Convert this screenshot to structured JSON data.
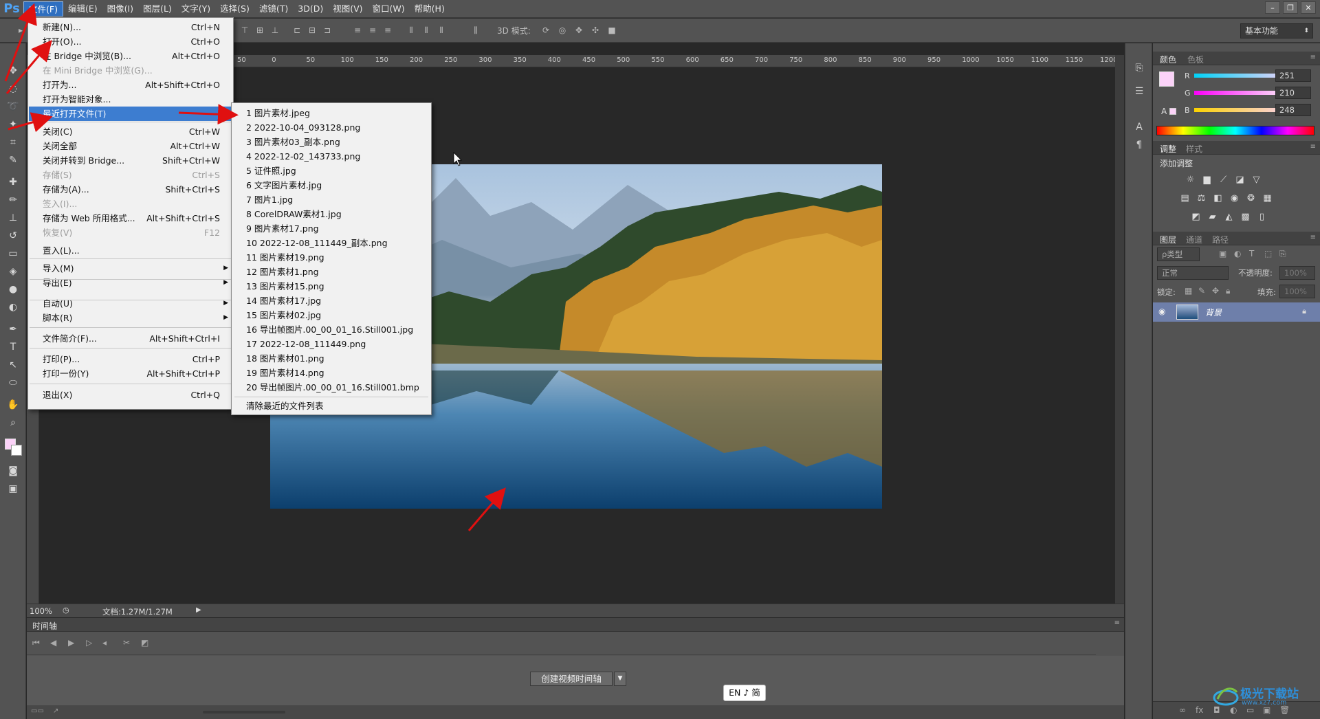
{
  "app": {
    "logo": "Ps"
  },
  "menubar": {
    "items": [
      "文件(F)",
      "编辑(E)",
      "图像(I)",
      "图层(L)",
      "文字(Y)",
      "选择(S)",
      "滤镜(T)",
      "3D(D)",
      "视图(V)",
      "窗口(W)",
      "帮助(H)"
    ],
    "active": "文件(F)",
    "window_controls": [
      "minimize",
      "restore",
      "close"
    ]
  },
  "options_bar": {
    "mode_label": "3D 模式:",
    "workspace": "基本功能"
  },
  "ruler": {
    "ticks": [
      "50",
      "0",
      "50",
      "100",
      "150",
      "200",
      "250",
      "300",
      "350",
      "400",
      "450",
      "500",
      "550",
      "600",
      "650",
      "700",
      "750",
      "800",
      "850",
      "900",
      "950",
      "1000",
      "1050",
      "1100",
      "1150",
      "1200"
    ]
  },
  "status": {
    "zoom": "100%",
    "doc_info": "文档:1.27M/1.27M"
  },
  "timeline": {
    "title": "时间轴",
    "create_button": "创建视频时间轴"
  },
  "ime": {
    "text": "EN ♪ 简"
  },
  "panels": {
    "color_tabs": [
      "颜色",
      "色板"
    ],
    "color": {
      "fg": "#fbd2f8",
      "r_label": "R",
      "g_label": "G",
      "b_label": "B",
      "r": "251",
      "g": "210",
      "b": "248"
    },
    "adj_tabs": [
      "调整",
      "样式"
    ],
    "adj_title": "添加调整",
    "layers_tabs": [
      "图层",
      "通道",
      "路径"
    ],
    "layer_filter": "ρ类型",
    "blend_mode": "正常",
    "opacity_label": "不透明度:",
    "opacity_value": "100%",
    "lock_label": "锁定:",
    "fill_label": "填充:",
    "fill_value": "100%",
    "layer_name": "背景"
  },
  "file_menu": {
    "items": [
      {
        "label": "新建(N)...",
        "shortcut": "Ctrl+N"
      },
      {
        "label": "打开(O)...",
        "shortcut": "Ctrl+O"
      },
      {
        "label": "在 Bridge 中浏览(B)...",
        "shortcut": "Alt+Ctrl+O"
      },
      {
        "label": "在 Mini Bridge 中浏览(G)...",
        "shortcut": "",
        "disabled": true
      },
      {
        "label": "打开为...",
        "shortcut": "Alt+Shift+Ctrl+O"
      },
      {
        "label": "打开为智能对象...",
        "shortcut": ""
      },
      {
        "label": "最近打开文件(T)",
        "shortcut": "",
        "submenu": true,
        "highlighted": true
      },
      {
        "label": "关闭(C)",
        "shortcut": "Ctrl+W"
      },
      {
        "label": "关闭全部",
        "shortcut": "Alt+Ctrl+W"
      },
      {
        "label": "关闭并转到 Bridge...",
        "shortcut": "Shift+Ctrl+W"
      },
      {
        "label": "存储(S)",
        "shortcut": "Ctrl+S",
        "disabled": true
      },
      {
        "label": "存储为(A)...",
        "shortcut": "Shift+Ctrl+S"
      },
      {
        "label": "签入(I)...",
        "shortcut": "",
        "disabled": true
      },
      {
        "label": "存储为 Web 所用格式...",
        "shortcut": "Alt+Shift+Ctrl+S"
      },
      {
        "label": "恢复(V)",
        "shortcut": "F12",
        "disabled": true
      },
      {
        "label": "置入(L)...",
        "shortcut": ""
      },
      {
        "label": "导入(M)",
        "shortcut": "",
        "submenu": true
      },
      {
        "label": "导出(E)",
        "shortcut": "",
        "submenu": true
      },
      {
        "label": "自动(U)",
        "shortcut": "",
        "submenu": true
      },
      {
        "label": "脚本(R)",
        "shortcut": "",
        "submenu": true
      },
      {
        "label": "文件简介(F)...",
        "shortcut": "Alt+Shift+Ctrl+I"
      },
      {
        "label": "打印(P)...",
        "shortcut": "Ctrl+P"
      },
      {
        "label": "打印一份(Y)",
        "shortcut": "Alt+Shift+Ctrl+P"
      },
      {
        "label": "退出(X)",
        "shortcut": "Ctrl+Q"
      }
    ]
  },
  "recent_menu": {
    "items": [
      "1  图片素材.jpeg",
      "2  2022-10-04_093128.png",
      "3  图片素材03_副本.png",
      "4  2022-12-02_143733.png",
      "5  证件照.jpg",
      "6  文字图片素材.jpg",
      "7  图片1.jpg",
      "8  CorelDRAW素材1.jpg",
      "9  图片素材17.png",
      "10  2022-12-08_111449_副本.png",
      "11  图片素材19.png",
      "12  图片素材1.png",
      "13  图片素材15.png",
      "14  图片素材17.jpg",
      "15  图片素材02.jpg",
      "16  导出帧图片.00_00_01_16.Still001.jpg",
      "17  2022-12-08_111449.png",
      "18  图片素材01.png",
      "19  图片素材14.png",
      "20  导出帧图片.00_00_01_16.Still001.bmp"
    ],
    "clear_label": "清除最近的文件列表"
  },
  "watermark": {
    "text": "极光下载站",
    "url": "www.xz7.com"
  }
}
